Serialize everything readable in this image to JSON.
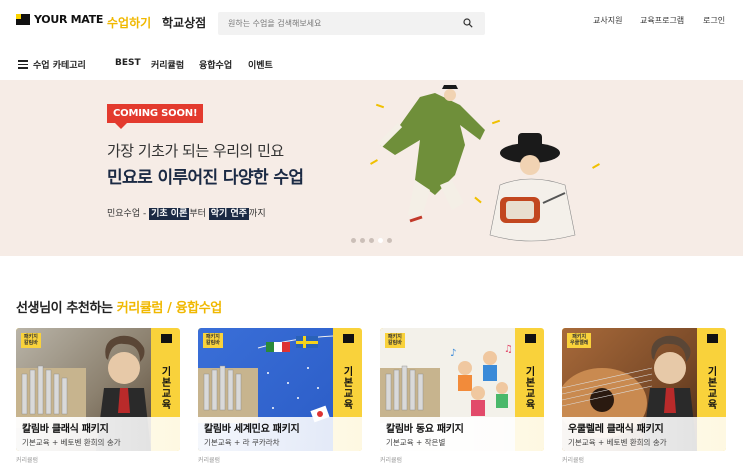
{
  "header": {
    "logo_text": "YOUR MATE",
    "nav": [
      "수업하기",
      "학교상점"
    ],
    "search_placeholder": "원하는 수업을 검색해보세요",
    "util_links": [
      "교사지원",
      "교육프로그램",
      "로그인"
    ]
  },
  "subnav": {
    "category_label": "수업 카테고리",
    "items": [
      "BEST",
      "커리큘럼",
      "융합수업",
      "이벤트"
    ]
  },
  "banner": {
    "badge": "COMING SOON!",
    "subtitle": "가장 기초가 되는 우리의 민요",
    "title": "민요로 이루어진 다양한 수업",
    "desc_prefix": "민요수업 - ",
    "desc_hl1": "기초 이론",
    "desc_mid": "부터 ",
    "desc_hl2": "악기 연주",
    "desc_suffix": "까지",
    "slide_count": 5,
    "active_slide": 4
  },
  "section": {
    "title_prefix": "선생님이 추천하는 ",
    "title_accent": "커리큘럼 / 융합수업"
  },
  "cards": [
    {
      "tag": "패키지\n칼림바",
      "vertical": "기본교육",
      "title": "칼림바 클래식 패키지",
      "sub": "기본교육 + 베토벤 환희의 송가",
      "foot": "커리큘럼"
    },
    {
      "tag": "패키지\n칼림바",
      "vertical": "기본교육",
      "title": "칼림바 세계민요 패키지",
      "sub": "기본교육 + 라 쿠카라차",
      "foot": "커리큘럼"
    },
    {
      "tag": "패키지\n칼림바",
      "vertical": "기본교육",
      "title": "칼림바 동요 패키지",
      "sub": "기본교육 + 작은별",
      "foot": "커리큘럼"
    },
    {
      "tag": "패키지\n우쿨렐레",
      "vertical": "기본교육",
      "title": "우쿨렐레 클래식 패키지",
      "sub": "기본교육 + 베토벤 환희의 송가",
      "foot": "커리큘럼"
    }
  ]
}
